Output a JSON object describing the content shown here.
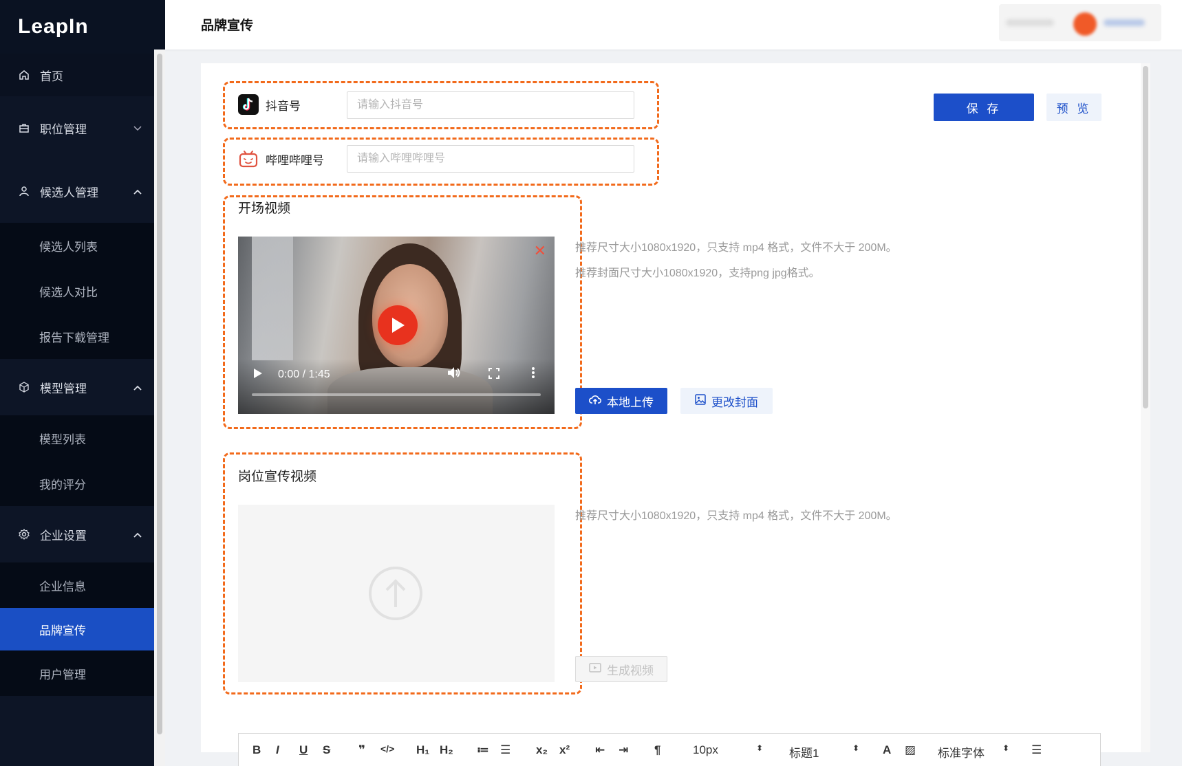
{
  "app": {
    "logo": "LeapIn"
  },
  "header": {
    "title": "品牌宣传"
  },
  "sidebar": {
    "items": [
      {
        "label": "首页",
        "icon": "home-icon"
      },
      {
        "label": "职位管理",
        "icon": "briefcase-icon",
        "chevron": "⌄"
      },
      {
        "label": "候选人管理",
        "icon": "user-icon",
        "chevron": "⌃"
      },
      {
        "label": "候选人列表"
      },
      {
        "label": "候选人对比"
      },
      {
        "label": "报告下载管理"
      },
      {
        "label": "模型管理",
        "icon": "cube-icon",
        "chevron": "⌃"
      },
      {
        "label": "模型列表"
      },
      {
        "label": "我的评分"
      },
      {
        "label": "企业设置",
        "icon": "gear-icon",
        "chevron": "⌃"
      },
      {
        "label": "企业信息"
      },
      {
        "label": "品牌宣传",
        "active": true
      },
      {
        "label": "用户管理"
      }
    ]
  },
  "toolbar": {
    "save_label": "保 存",
    "preview_label": "预 览"
  },
  "social": {
    "douyin": {
      "label": "抖音号",
      "placeholder": "请输入抖音号",
      "icon": "tiktok-icon"
    },
    "bilibili": {
      "label": "哔哩哔哩号",
      "placeholder": "请输入哔哩哔哩号",
      "icon": "bilibili-icon"
    }
  },
  "opening_video": {
    "title": "开场视频",
    "time": "0:00 / 1:45",
    "progress": 0,
    "hint1": "推荐尺寸大小1080x1920，只支持 mp4 格式，文件不大于 200M。",
    "hint2": "推荐封面尺寸大小1080x1920，支持png jpg格式。",
    "upload_label": "本地上传",
    "cover_label": "更改封面"
  },
  "job_video": {
    "title": "岗位宣传视频",
    "hint": "推荐尺寸大小1080x1920，只支持 mp4 格式，文件不大于 200M。",
    "generate_label": "生成视频"
  },
  "editor": {
    "buttons": [
      "B",
      "I",
      "U",
      "S",
      "❞",
      "</>",
      "H₁",
      "H₂",
      "≔",
      "☰",
      "x₂",
      "x²",
      "⇤",
      "⇥",
      "¶"
    ],
    "font_size": "10px",
    "heading": "标题1",
    "font_family": "标准字体"
  },
  "colors": {
    "primary": "#1c4fc9",
    "sidebar_bg": "#0d1526",
    "highlight": "#f26a1b"
  }
}
